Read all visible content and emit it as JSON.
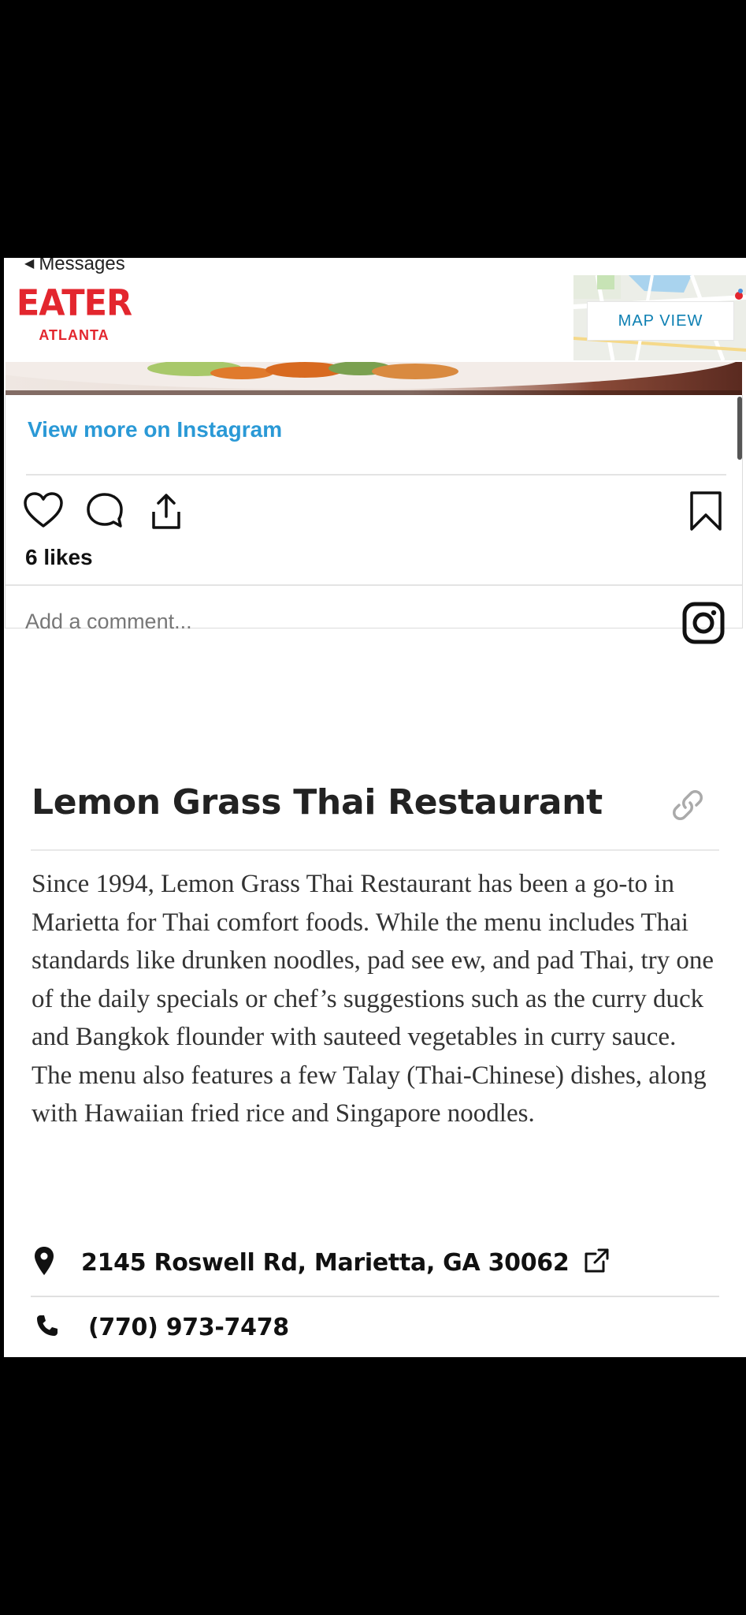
{
  "status": {
    "back_label": "Messages"
  },
  "header": {
    "logo_main": "EATER",
    "logo_city": "ATLANTA",
    "map_button": "MAP VIEW"
  },
  "instagram": {
    "view_more": "View more on Instagram",
    "likes": "6 likes",
    "comment_placeholder": "Add a comment..."
  },
  "place": {
    "title": "Lemon Grass Thai Restaurant",
    "description": "Since 1994, Lemon Grass Thai Restaurant has been a go-to in Marietta for Thai comfort foods. While the menu includes Thai standards like drunken noodles, pad see ew, and pad Thai, try one of the daily specials or chef’s suggestions such as the curry duck and Bangkok flounder with sauteed vegetables in curry sauce. The menu also features a few Talay (Thai-Chinese) dishes, along with Hawaiian fried rice and Singapore noodles.",
    "address": "2145 Roswell Rd, Marietta, GA 30062",
    "phone": "(770) 973-7478"
  },
  "colors": {
    "brand_red": "#e3262e",
    "link_blue": "#2a99d6",
    "map_button_blue": "#0c7fb2"
  },
  "icons": [
    "back-arrow-icon",
    "heart-icon",
    "comment-icon",
    "share-icon",
    "bookmark-icon",
    "instagram-icon",
    "link-icon",
    "location-pin-icon",
    "external-link-icon",
    "phone-icon"
  ]
}
